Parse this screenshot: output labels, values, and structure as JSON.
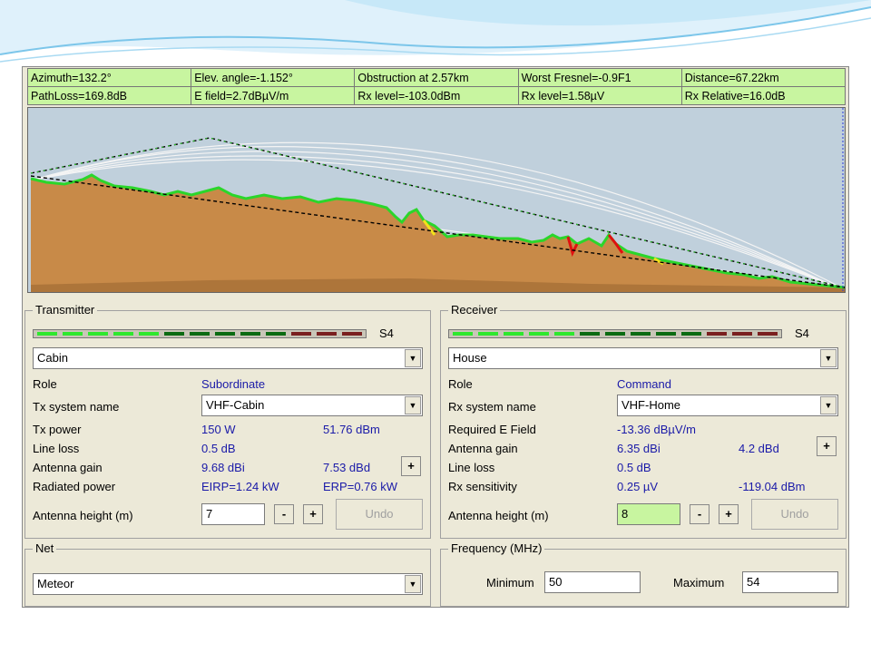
{
  "info": {
    "row1": [
      "Azimuth=132.2°",
      "Elev. angle=-1.152°",
      "Obstruction at 2.57km",
      "Worst Fresnel=-0.9F1",
      "Distance=67.22km"
    ],
    "row2": [
      "PathLoss=169.8dB",
      "E field=2.7dBµV/m",
      "Rx level=-103.0dBm",
      "Rx level=1.58µV",
      "Rx Relative=16.0dB"
    ]
  },
  "transmitter": {
    "title": "Transmitter",
    "signal": "S4",
    "site": "Cabin",
    "role_label": "Role",
    "role_value": "Subordinate",
    "system_label": "Tx system name",
    "system_value": "VHF-Cabin",
    "power_label": "Tx power",
    "power_w": "150 W",
    "power_dbm": "51.76 dBm",
    "loss_label": "Line loss",
    "loss_value": "0.5 dB",
    "gain_label": "Antenna gain",
    "gain_dbi": "9.68 dBi",
    "gain_dbd": "7.53 dBd",
    "radiated_label": "Radiated power",
    "eirp": "EIRP=1.24 kW",
    "erp": "ERP=0.76 kW",
    "height_label": "Antenna height (m)",
    "height_value": "7",
    "minus": "-",
    "plus": "+",
    "undo": "Undo"
  },
  "receiver": {
    "title": "Receiver",
    "signal": "S4",
    "site": "House",
    "role_label": "Role",
    "role_value": "Command",
    "system_label": "Rx system name",
    "system_value": "VHF-Home",
    "efield_label": "Required E Field",
    "efield_value": "-13.36 dBµV/m",
    "gain_label": "Antenna gain",
    "gain_dbi": "6.35 dBi",
    "gain_dbd": "4.2 dBd",
    "loss_label": "Line loss",
    "loss_value": "0.5 dB",
    "sens_label": "Rx sensitivity",
    "sens_uv": "0.25 µV",
    "sens_dbm": "-119.04 dBm",
    "height_label": "Antenna height (m)",
    "height_value": "8",
    "minus": "-",
    "plus": "+",
    "undo": "Undo"
  },
  "net": {
    "title": "Net",
    "value": "Meteor"
  },
  "frequency": {
    "title": "Frequency (MHz)",
    "min_label": "Minimum",
    "min_value": "50",
    "max_label": "Maximum",
    "max_value": "54"
  },
  "meter": {
    "segment_colors": [
      "#2ee82e",
      "#2ee82e",
      "#2ee82e",
      "#2ee82e",
      "#2ee82e",
      "#0b6b12",
      "#0b6b12",
      "#0b6b12",
      "#0b6b12",
      "#0b6b12",
      "#7a1f1f",
      "#7a1f1f",
      "#7a1f1f"
    ],
    "level": 0.38
  },
  "colors": {
    "terrain": "#c88a48",
    "terrain_edge": "#2bd62b",
    "sky": "#c0d0dc",
    "info_bg": "#c8f5a0"
  }
}
